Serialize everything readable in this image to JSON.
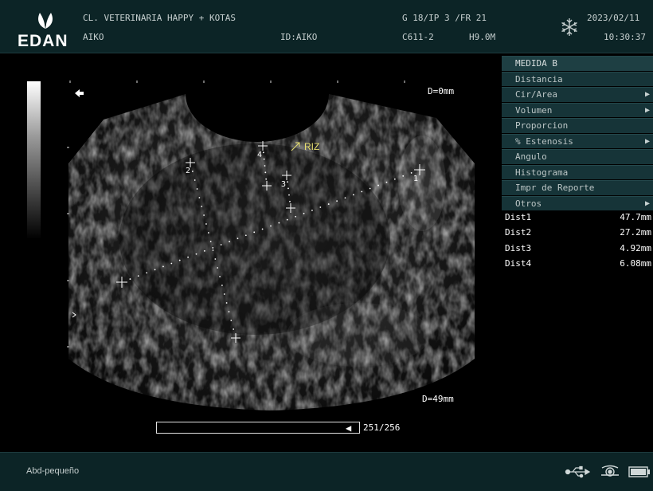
{
  "header": {
    "logo": "EDAN",
    "clinic": "CL. VETERINARIA HAPPY + KOTAS",
    "patient": "AIKO",
    "id": "ID:AIKO",
    "gain": "G 18/IP 3 /FR 21",
    "probe": "C611-2",
    "freq": "H9.0M",
    "date": "2023/02/11",
    "time": "10:30:37",
    "freeze_icon": "snowflake-icon"
  },
  "image": {
    "depth_top": "D=0mm",
    "depth_bottom": "D=49mm",
    "annotation": "RIZ",
    "markers": [
      "1",
      "2",
      "3",
      "4"
    ],
    "cine_frame": "251/256"
  },
  "menu": {
    "items": [
      {
        "label": "MEDIDA B",
        "arrow": false,
        "head": true
      },
      {
        "label": "Distancia",
        "arrow": false
      },
      {
        "label": "Cir/Area",
        "arrow": true
      },
      {
        "label": "Volumen",
        "arrow": true
      },
      {
        "label": "Proporcion",
        "arrow": false
      },
      {
        "label": "% Estenosis",
        "arrow": true
      },
      {
        "label": "Angulo",
        "arrow": false
      },
      {
        "label": "Histograma",
        "arrow": false
      },
      {
        "label": "Impr de Reporte",
        "arrow": false
      },
      {
        "label": "Otros",
        "arrow": true
      }
    ]
  },
  "measurements": [
    {
      "name": "Dist1",
      "value": "47.7mm"
    },
    {
      "name": "Dist2",
      "value": "27.2mm"
    },
    {
      "name": "Dist3",
      "value": "4.92mm"
    },
    {
      "name": "Dist4",
      "value": "6.08mm"
    }
  ],
  "footer": {
    "preset": "Abd-pequeño",
    "icons": [
      "usb-icon",
      "printer-icon",
      "battery-icon"
    ]
  }
}
